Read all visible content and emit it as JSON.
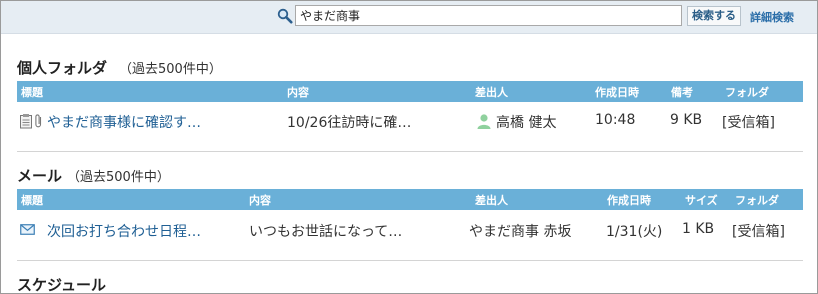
{
  "search": {
    "value": "やまだ商事",
    "button_label": "検索する",
    "advanced_label": "詳細検索"
  },
  "personal_folder": {
    "title": "個人フォルダ",
    "count": "（過去500件中）",
    "columns": [
      "標題",
      "内容",
      "差出人",
      "作成日時",
      "備考",
      "フォルダ"
    ],
    "row": {
      "subject": "やまだ商事様に確認す…",
      "content": "10/26往訪時に確…",
      "sender": "高橋 健太",
      "created": "10:48",
      "note": "9 KB",
      "folder": "[受信箱]"
    }
  },
  "mail": {
    "title": "メール",
    "count": "（過去500件中）",
    "columns": [
      "標題",
      "内容",
      "差出人",
      "作成日時",
      "サイズ",
      "フォルダ"
    ],
    "row": {
      "subject": "次回お打ち合わせ日程…",
      "content": "いつもお世話になって…",
      "sender": "やまだ商事 赤坂",
      "created": "1/31(火)",
      "size": "1 KB",
      "folder": "[受信箱]"
    }
  },
  "schedule": {
    "title": "スケジュール"
  },
  "colors": {
    "header_bar": "#6ab0d8",
    "link": "#1f5f94",
    "topbar": "#e6edf3"
  }
}
